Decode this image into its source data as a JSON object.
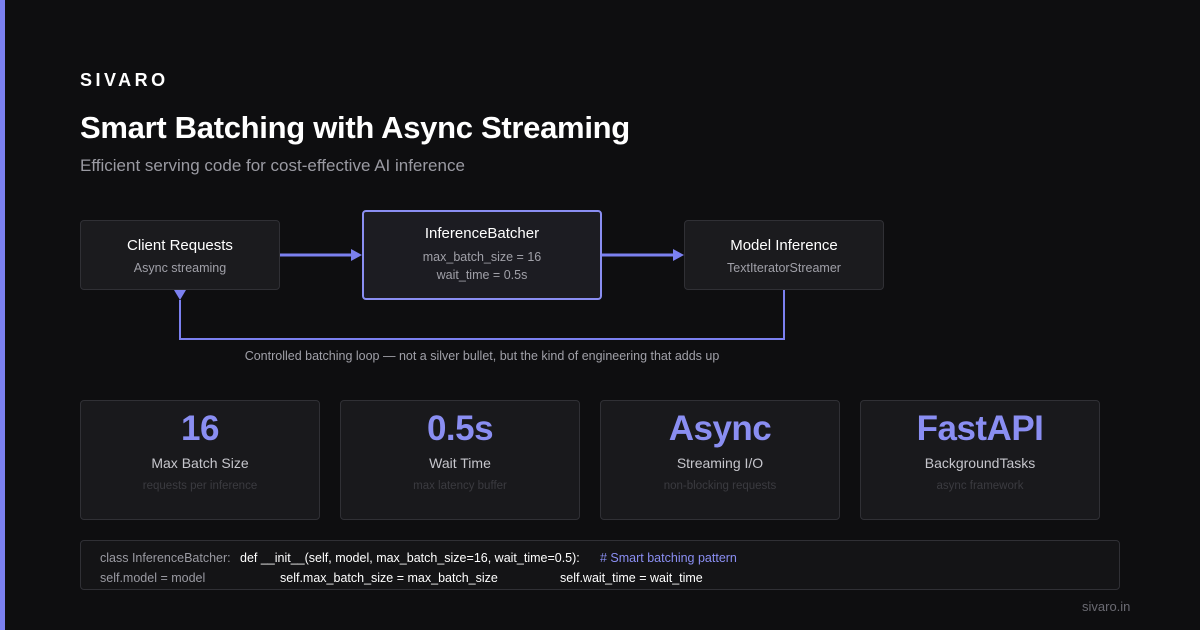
{
  "brand": "SIVARO",
  "title": "Smart Batching with Async Streaming",
  "subtitle": "Efficient serving code for cost-effective AI inference",
  "colors": {
    "accent": "#8a8ef2",
    "background": "#0e0e10",
    "panel": "#1b1b1e"
  },
  "flow": {
    "client": {
      "title": "Client Requests",
      "sub": "Async streaming"
    },
    "batcher": {
      "title": "InferenceBatcher",
      "line1": "max_batch_size = 16",
      "line2": "wait_time = 0.5s"
    },
    "model": {
      "title": "Model Inference",
      "sub": "TextIteratorStreamer"
    },
    "loop_caption": "Controlled batching loop — not a silver bullet, but the kind of engineering that adds up"
  },
  "stats": [
    {
      "value": "16",
      "label": "Max Batch Size",
      "note": "requests per inference"
    },
    {
      "value": "0.5s",
      "label": "Wait Time",
      "note": "max latency buffer"
    },
    {
      "value": "Async",
      "label": "Streaming I/O",
      "note": "non-blocking requests"
    },
    {
      "value": "FastAPI",
      "label": "BackgroundTasks",
      "note": "async framework"
    }
  ],
  "code": {
    "line1_a": "class InferenceBatcher:",
    "line1_b": "def __init__(self, model, max_batch_size=16, wait_time=0.5):",
    "line1_comment": "# Smart batching pattern",
    "line2_a": "self.model = model",
    "line2_b": "self.max_batch_size = max_batch_size",
    "line2_c": "self.wait_time = wait_time"
  },
  "footer": "sivaro.in"
}
